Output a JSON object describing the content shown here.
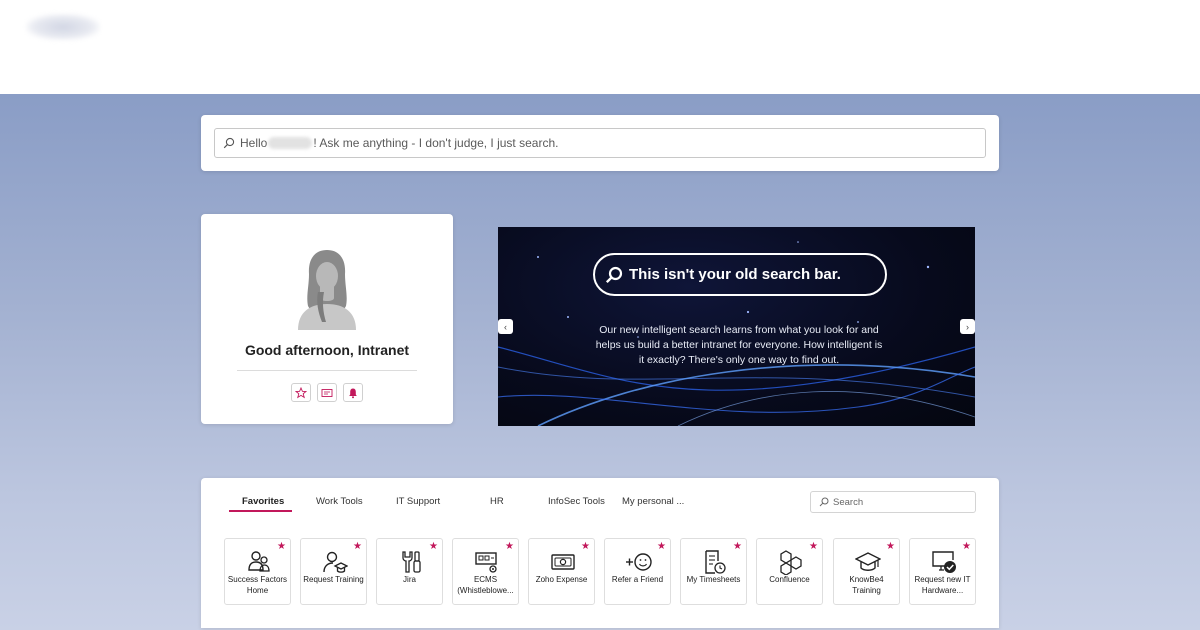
{
  "search": {
    "prefix": "Hello",
    "suffix": "! Ask me anything - I don't judge, I just search."
  },
  "profile": {
    "greeting": "Good afternoon, Intranet",
    "quick_actions": [
      "star-icon",
      "id-card-icon",
      "bell-icon"
    ]
  },
  "banner": {
    "headline": "This isn't your old search bar.",
    "body": "Our new intelligent search learns from what you look for and helps us build a better intranet for everyone. How intelligent is it exactly? There's only one way to find out.",
    "prev_label": "‹",
    "next_label": "›"
  },
  "tools": {
    "tabs": [
      "Favorites",
      "Work Tools",
      "IT Support",
      "HR",
      "InfoSec Tools",
      "My personal ..."
    ],
    "active_tab": "Favorites",
    "search_placeholder": "Search",
    "tiles": [
      {
        "label": "Success Factors Home",
        "icon": "people-icon"
      },
      {
        "label": "Request Training",
        "icon": "person-graduate-icon"
      },
      {
        "label": "Jira",
        "icon": "tools-icon"
      },
      {
        "label": "ECMS (Whistleblowe...",
        "icon": "server-settings-icon"
      },
      {
        "label": "Zoho Expense",
        "icon": "money-icon"
      },
      {
        "label": "Refer a Friend",
        "icon": "add-smiley-icon"
      },
      {
        "label": "My Timesheets",
        "icon": "timesheet-icon"
      },
      {
        "label": "Confluence",
        "icon": "hexagons-icon"
      },
      {
        "label": "KnowBe4 Training",
        "icon": "mortarboard-icon"
      },
      {
        "label": "Request new IT Hardware...",
        "icon": "monitor-check-icon"
      }
    ],
    "star_glyph": "★"
  },
  "colors": {
    "accent": "#c2185b",
    "hero_top": "#8a9dc6",
    "hero_bottom": "#c9d1e6",
    "banner_bg": "#070a1c"
  }
}
